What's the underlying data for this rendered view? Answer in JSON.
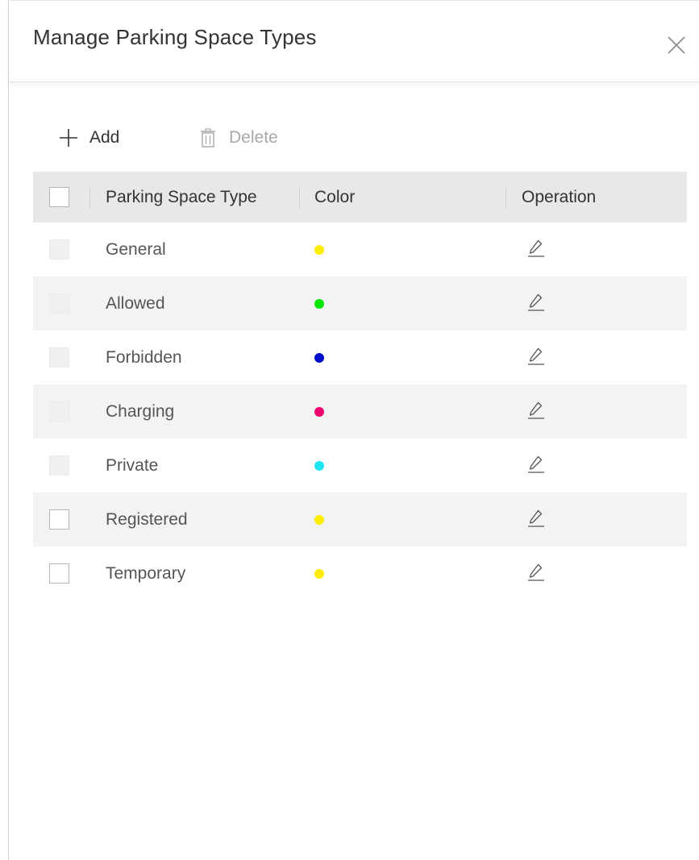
{
  "dialog": {
    "title": "Manage Parking Space Types",
    "close_icon": "close-icon"
  },
  "toolbar": {
    "add_label": "Add",
    "add_icon": "plus-icon",
    "delete_label": "Delete",
    "delete_icon": "trash-icon",
    "delete_enabled": false
  },
  "table": {
    "columns": [
      "Parking Space Type",
      "Color",
      "Operation"
    ],
    "rows": [
      {
        "name": "General",
        "color": "#ffee00",
        "editable_checkbox": false,
        "operation_icon": "edit-pencil-icon"
      },
      {
        "name": "Allowed",
        "color": "#00e600",
        "editable_checkbox": false,
        "operation_icon": "edit-pencil-icon"
      },
      {
        "name": "Forbidden",
        "color": "#0010c8",
        "editable_checkbox": false,
        "operation_icon": "edit-pencil-icon"
      },
      {
        "name": "Charging",
        "color": "#f0056e",
        "editable_checkbox": false,
        "operation_icon": "edit-pencil-icon"
      },
      {
        "name": "Private",
        "color": "#1ee6f0",
        "editable_checkbox": false,
        "operation_icon": "edit-pencil-icon"
      },
      {
        "name": "Registered",
        "color": "#ffee00",
        "editable_checkbox": true,
        "operation_icon": "edit-pencil-icon"
      },
      {
        "name": "Temporary",
        "color": "#ffee00",
        "editable_checkbox": true,
        "operation_icon": "edit-pencil-icon"
      }
    ]
  }
}
